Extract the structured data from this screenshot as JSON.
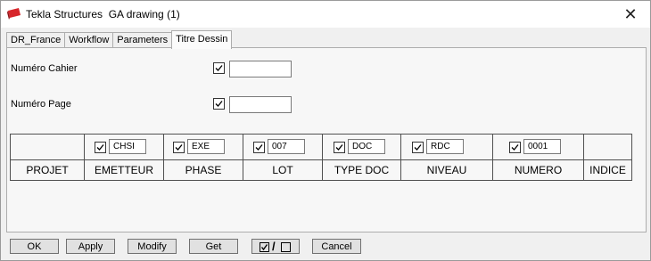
{
  "window": {
    "title": "Tekla Structures  GA drawing (1)",
    "close_icon": "close-icon"
  },
  "tabs": [
    {
      "label": "DR_France",
      "active": false
    },
    {
      "label": "Workflow",
      "active": false
    },
    {
      "label": "Parameters",
      "active": false
    },
    {
      "label": "Titre Dessin",
      "active": true
    }
  ],
  "fields": {
    "cahier": {
      "label": "Numéro Cahier",
      "checked": true,
      "value": ""
    },
    "page": {
      "label": "Numéro Page",
      "checked": true,
      "value": ""
    }
  },
  "grid": {
    "columns": [
      {
        "name": "PROJET",
        "has_input": false,
        "checked": false,
        "value": ""
      },
      {
        "name": "EMETTEUR",
        "has_input": true,
        "checked": true,
        "value": "CHSI"
      },
      {
        "name": "PHASE",
        "has_input": true,
        "checked": true,
        "value": "EXE"
      },
      {
        "name": "LOT",
        "has_input": true,
        "checked": true,
        "value": "007"
      },
      {
        "name": "TYPE DOC",
        "has_input": true,
        "checked": true,
        "value": "DOC"
      },
      {
        "name": "NIVEAU",
        "has_input": true,
        "checked": true,
        "value": "RDC"
      },
      {
        "name": "NUMERO",
        "has_input": true,
        "checked": true,
        "value": "0001"
      },
      {
        "name": "INDICE",
        "has_input": false,
        "checked": false,
        "value": ""
      }
    ]
  },
  "buttons": {
    "ok": "OK",
    "apply": "Apply",
    "modify": "Modify",
    "get": "Get",
    "toggle_slash": "/",
    "cancel": "Cancel"
  }
}
